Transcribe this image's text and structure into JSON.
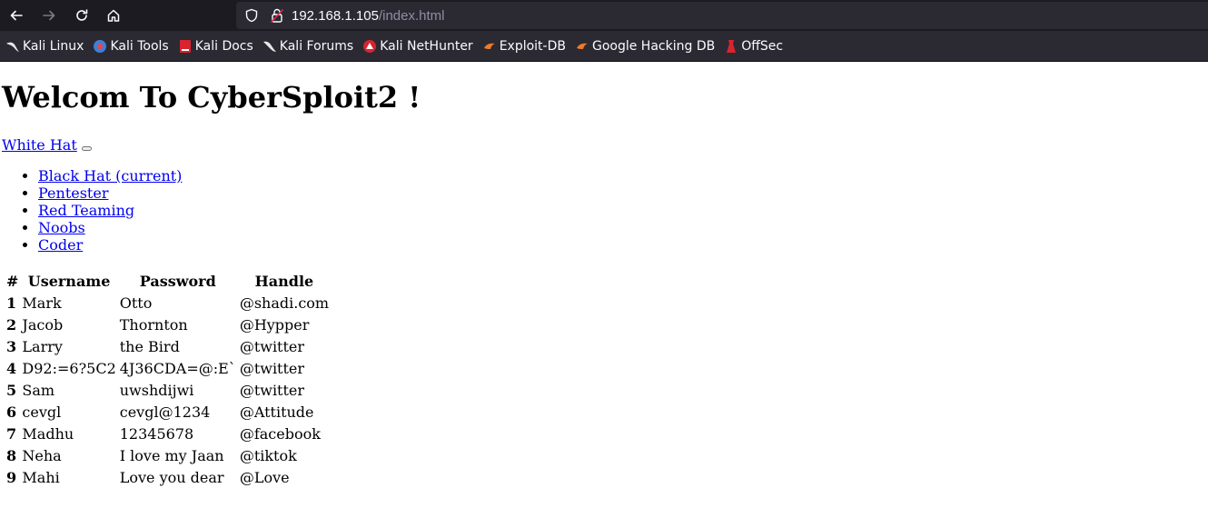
{
  "browser": {
    "url_host": "192.168.1.105",
    "url_path": "/index.html",
    "bookmarks": [
      {
        "label": "Kali Linux",
        "icon": "kali-dragon-icon"
      },
      {
        "label": "Kali Tools",
        "icon": "kali-tools-icon"
      },
      {
        "label": "Kali Docs",
        "icon": "kali-docs-icon"
      },
      {
        "label": "Kali Forums",
        "icon": "kali-forums-icon"
      },
      {
        "label": "Kali NetHunter",
        "icon": "nethunter-icon"
      },
      {
        "label": "Exploit-DB",
        "icon": "exploit-db-icon"
      },
      {
        "label": "Google Hacking DB",
        "icon": "ghdb-icon"
      },
      {
        "label": "OffSec",
        "icon": "offsec-icon"
      }
    ]
  },
  "page": {
    "title": "Welcom To CyberSploit2 !",
    "brand": "White Hat",
    "nav": [
      "Black Hat (current)",
      "Pentester",
      "Red Teaming",
      "Noobs",
      "Coder"
    ],
    "table": {
      "headers": [
        "#",
        "Username",
        "Password",
        "Handle"
      ],
      "rows": [
        [
          "1",
          "Mark",
          "Otto",
          "@shadi.com"
        ],
        [
          "2",
          "Jacob",
          "Thornton",
          "@Hypper"
        ],
        [
          "3",
          "Larry",
          "the Bird",
          "@twitter"
        ],
        [
          "4",
          "D92:=6?5C2",
          "4J36CDA=@:E`",
          "@twitter"
        ],
        [
          "5",
          "Sam",
          "uwshdijwi",
          "@twitter"
        ],
        [
          "6",
          "cevgl",
          "cevgl@1234",
          "@Attitude"
        ],
        [
          "7",
          "Madhu",
          "12345678",
          "@facebook"
        ],
        [
          "8",
          "Neha",
          "I love my Jaan",
          "@tiktok"
        ],
        [
          "9",
          "Mahi",
          "Love you dear",
          "@Love"
        ]
      ]
    }
  }
}
